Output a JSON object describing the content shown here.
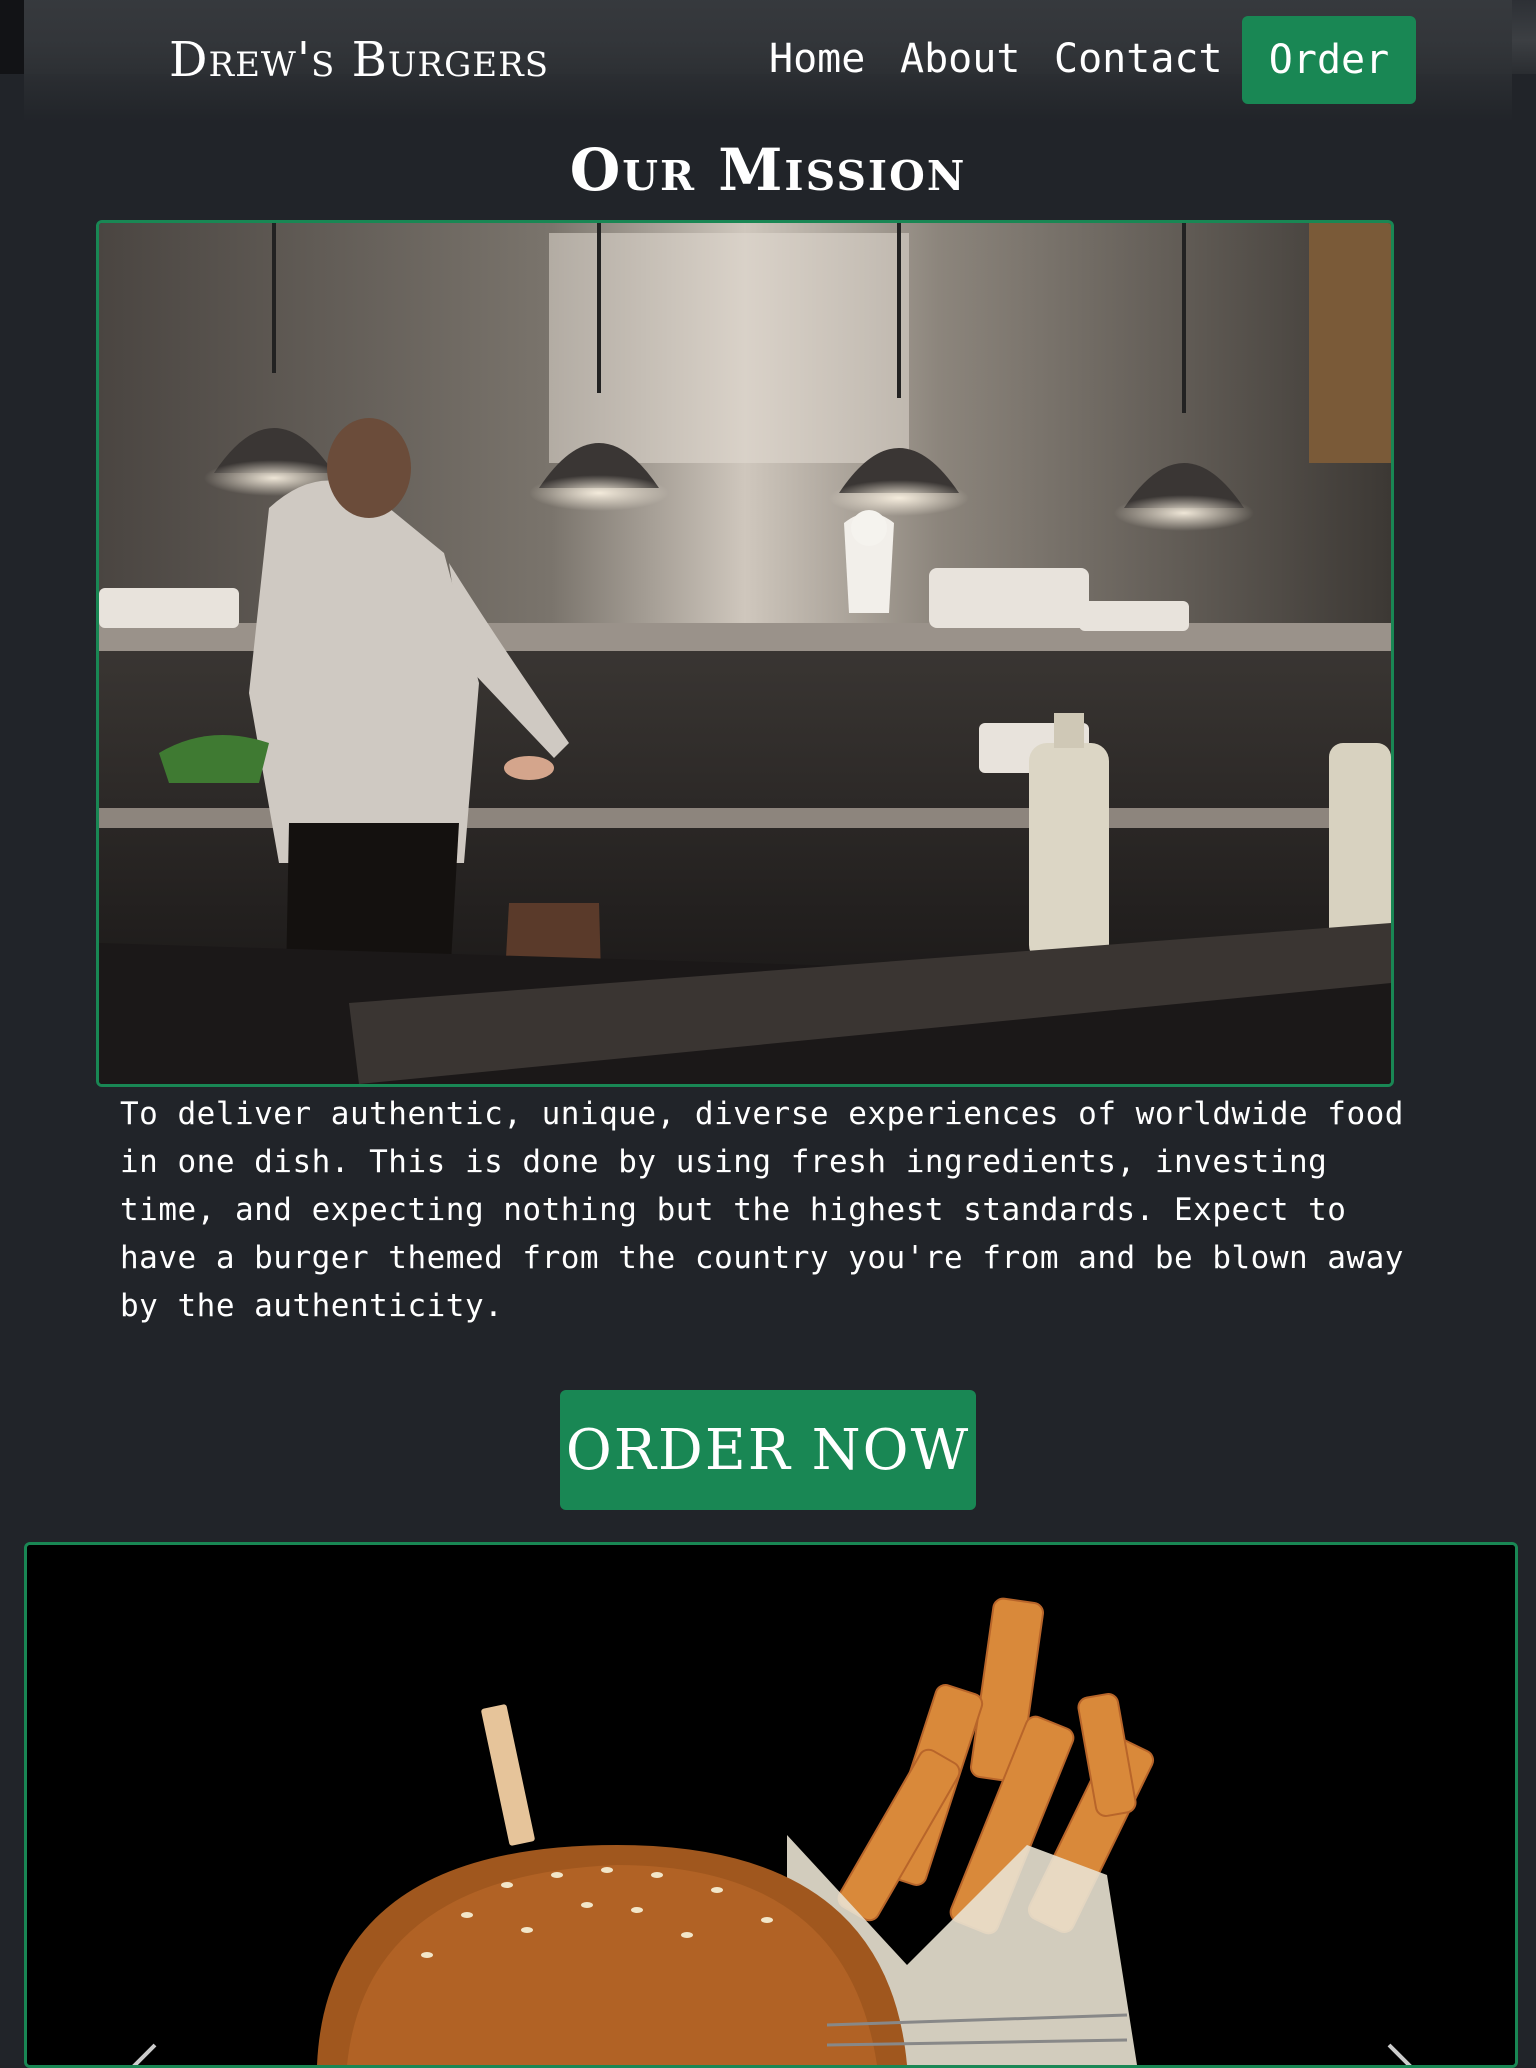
{
  "navbar": {
    "brand": "Drew's Burgers",
    "links": [
      {
        "label": "Home"
      },
      {
        "label": "About"
      },
      {
        "label": "Contact"
      }
    ],
    "order_button": "Order"
  },
  "mission": {
    "title": "Our Mission",
    "image_alt": "Restaurant kitchen with chefs at work",
    "text": "To deliver authentic, unique, diverse experiences of worldwide food in one dish. This is done by using fresh ingredients, investing time, and expecting nothing but the highest standards. Expect to have a burger themed from the country you're from and be blown away by the authenticity."
  },
  "cta": {
    "order_now": "ORDER NOW"
  },
  "carousel": {
    "image_alt": "Burger with fries in a basket",
    "prev_icon": "chevron-left-icon",
    "next_icon": "chevron-right-icon"
  },
  "colors": {
    "background": "#212429",
    "accent": "#198754",
    "text": "#ffffff"
  }
}
